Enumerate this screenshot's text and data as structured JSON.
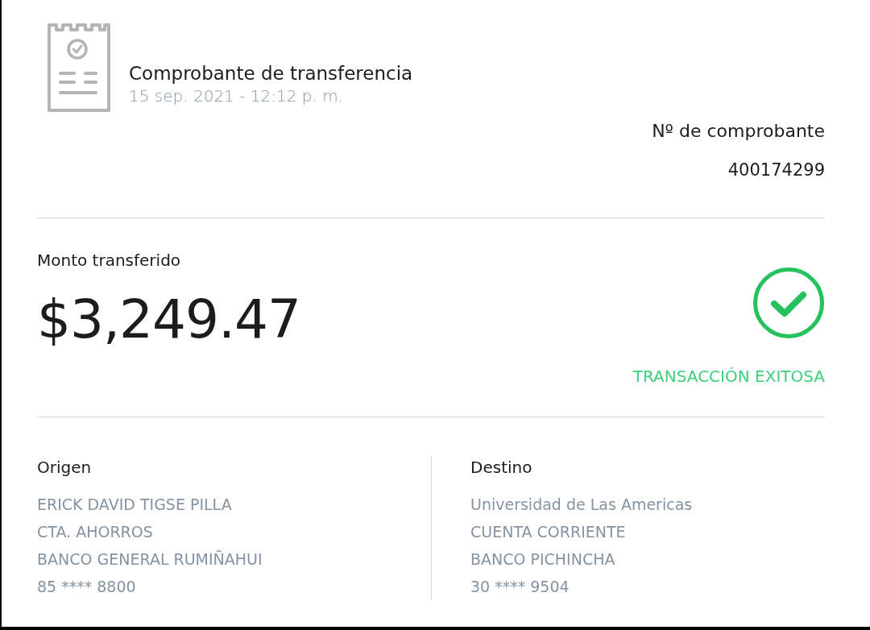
{
  "header": {
    "title": "Comprobante de transferencia",
    "date": "15 sep. 2021 - 12:12 p. m."
  },
  "receipt_number": {
    "label": "Nº de comprobante",
    "value": "400174299"
  },
  "amount": {
    "label": "Monto transferido",
    "value": "$3,249.47"
  },
  "status": {
    "kind": "success",
    "label": "TRANSACCIÓN EXITOSA"
  },
  "parties": [
    {
      "title": "Origen",
      "lines": [
        "ERICK DAVID TIGSE PILLA",
        "CTA. AHORROS",
        "BANCO GENERAL RUMIÑAHUI",
        "85 **** 8800"
      ]
    },
    {
      "title": "Destino",
      "lines": [
        "Universidad de Las Americas",
        "CUENTA CORRIENTE",
        "BANCO PICHINCHA",
        "30 **** 9504"
      ]
    }
  ]
}
